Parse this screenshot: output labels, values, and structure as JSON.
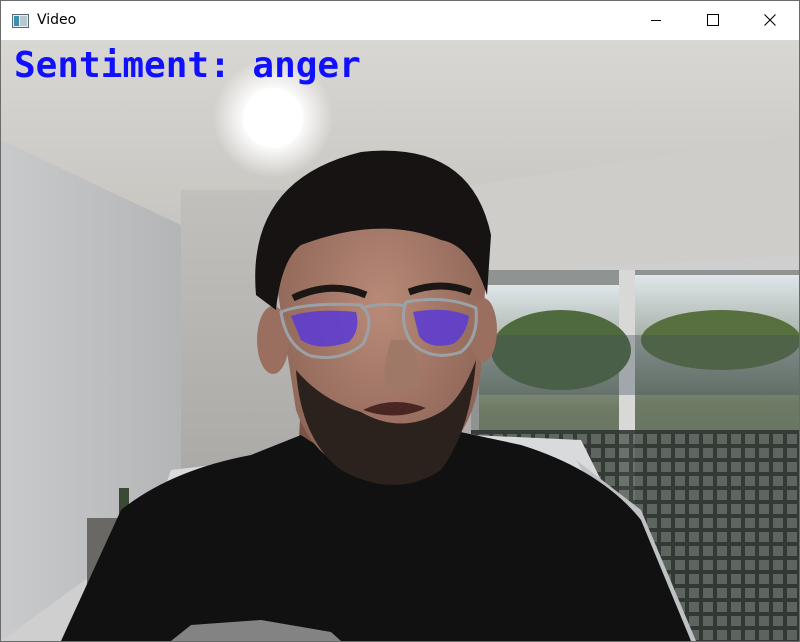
{
  "window": {
    "title": "Video",
    "app_icon": "video-window-icon",
    "controls": {
      "minimize_icon": "minimize-icon",
      "maximize_icon": "maximize-icon",
      "close_icon": "close-icon"
    }
  },
  "video": {
    "overlay_text": "Sentiment: anger",
    "overlay_color": "#1010ff"
  }
}
